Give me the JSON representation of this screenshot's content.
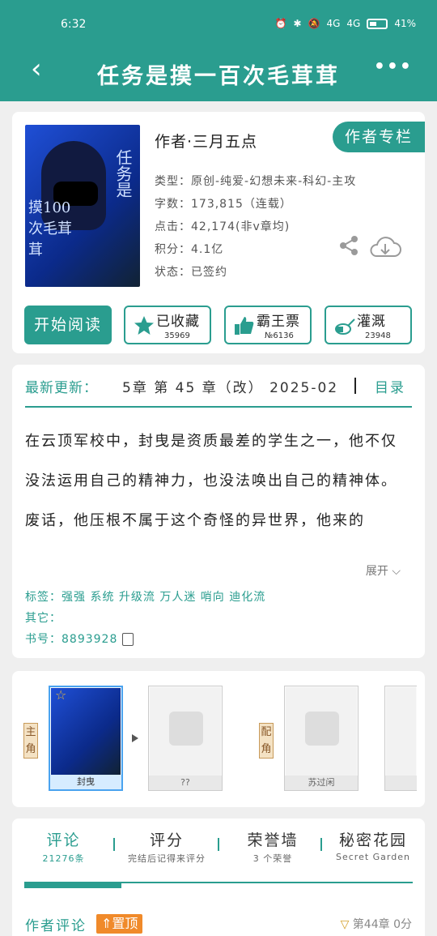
{
  "status_bar": {
    "time": "6:32",
    "battery": "41%",
    "net1": "4G",
    "net2": "4G"
  },
  "nav": {
    "title": "任务是摸一百次毛茸茸"
  },
  "book": {
    "author": "作者·三月五点",
    "author_column": "作者专栏",
    "type": "类型：原创-纯爱-幻想未来-科幻-主攻",
    "words": "字数：173,815（连载）",
    "clicks": "点击：42,174(非v章均)",
    "points": "积分：4.1亿",
    "status": "状态：已签约",
    "cover_text_vertical": "任务是",
    "cover_text_side": "摸100次毛茸茸"
  },
  "actions": {
    "read": "开始阅读",
    "collect": {
      "label": "已收藏",
      "count": "35969"
    },
    "ticket": {
      "label": "霸王票",
      "count": "№6136"
    },
    "water": {
      "label": "灌溉",
      "count": "23948"
    }
  },
  "detail": {
    "latest_label": "最新更新：",
    "latest_chapter": "5章  第 45 章（改）  2025-02",
    "toc": "目录",
    "intro_p1": "在云顶军校中，封曳是资质最差的学生之一，他不仅没法运用自己的精神力，也没法唤出自己的精神体。",
    "intro_p2": "废话，他压根不属于这个奇怪的异世界，他来的",
    "expand": "展开",
    "tags_label": "标签：",
    "tags": "强强 系统 升级流 万人迷 哨向 迪化流",
    "other_label": "其它：",
    "book_no_label": "书号：",
    "book_no": "8893928"
  },
  "roles": {
    "main_tag": "主角",
    "support_tag": "配角",
    "main_name": "封曳",
    "unknown_name": "??",
    "support_name": "苏过闲"
  },
  "reviews": {
    "tabs": [
      {
        "title": "评论",
        "sub": "21276条"
      },
      {
        "title": "评分",
        "sub": "完结后记得来评分"
      },
      {
        "title": "荣誉墙",
        "sub": "3 个荣誉"
      },
      {
        "title": "秘密花园",
        "sub": "Secret Garden"
      }
    ],
    "author_comment": "作者评论",
    "pin": "置顶",
    "chapter": "第44章",
    "score": "0分"
  },
  "colors": {
    "accent": "#2a9d8f",
    "pin": "#f08a2a"
  }
}
